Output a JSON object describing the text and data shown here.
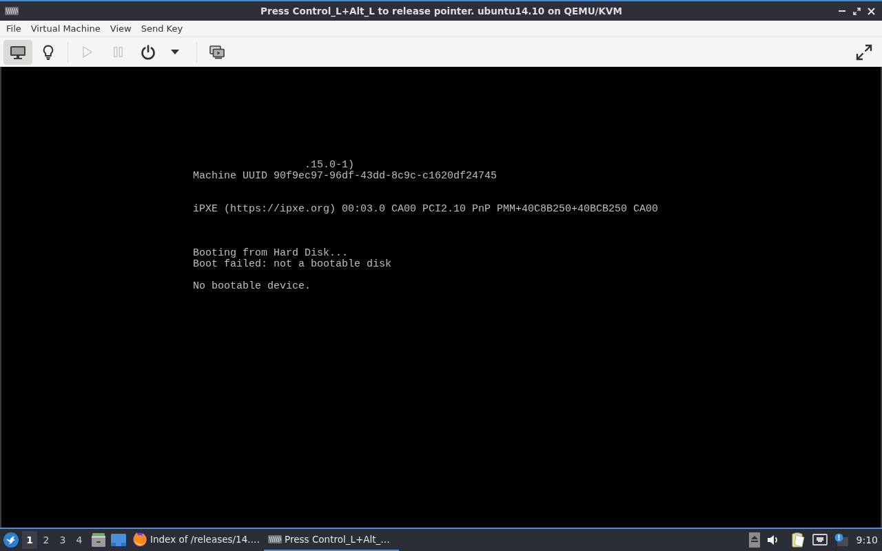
{
  "window": {
    "title": "Press Control_L+Alt_L to release pointer. ubuntu14.10 on QEMU/KVM",
    "controls": [
      {
        "kind": "minimize"
      },
      {
        "kind": "maximize"
      },
      {
        "kind": "close"
      }
    ]
  },
  "menubar": [
    "File",
    "Virtual Machine",
    "View",
    "Send Key"
  ],
  "toolbar": {
    "views": [
      {
        "kind": "console",
        "selected": true
      },
      {
        "kind": "details",
        "selected": false
      }
    ],
    "actions": [
      {
        "kind": "run",
        "disabled": true
      },
      {
        "kind": "pause",
        "disabled": true
      },
      {
        "kind": "shutdown",
        "disabled": false
      },
      {
        "kind": "shutdown-menu",
        "disabled": false
      }
    ],
    "tools": [
      {
        "kind": "snapshots"
      }
    ],
    "end": [
      {
        "kind": "fullscreen"
      }
    ]
  },
  "console": {
    "lines": [
      ".15.0-1)",
      "Machine UUID 90f9ec97-96df-43dd-8c9c-c1620df24745",
      "iPXE (https://ipxe.org) 00:03.0 CA00 PCI2.10 PnP PMM+40C8B250+40BCB250 CA00",
      "Booting from Hard Disk...",
      "Boot failed: not a bootable disk",
      "No bootable device."
    ]
  },
  "taskbar": {
    "start": {
      "kind": "start-menu"
    },
    "workspaces": [
      {
        "label": "1",
        "selected": true
      },
      {
        "label": "2",
        "selected": false
      },
      {
        "label": "3",
        "selected": false
      },
      {
        "label": "4",
        "selected": false
      }
    ],
    "launchers": [
      {
        "kind": "file-manager"
      },
      {
        "kind": "desktop"
      }
    ],
    "tasks": [
      {
        "kind": "browser",
        "title": "Index of /releases/14.…",
        "selected": false
      },
      {
        "kind": "vm-viewer",
        "title": "Press Control_L+Alt_…",
        "selected": true
      }
    ],
    "tray": [
      {
        "kind": "eject"
      },
      {
        "kind": "volume"
      },
      {
        "kind": "notes"
      },
      {
        "kind": "network"
      },
      {
        "kind": "notification"
      }
    ],
    "clock": "9:10"
  }
}
